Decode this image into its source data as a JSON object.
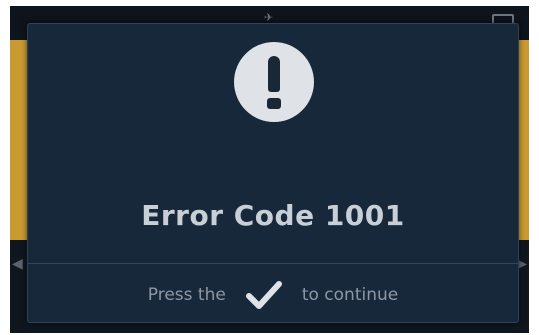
{
  "dialog": {
    "icon": "exclamation-circle-icon",
    "title": "Error Code 1001",
    "footer_prefix": "Press the",
    "footer_icon": "checkmark-icon",
    "footer_suffix": "to continue"
  },
  "colors": {
    "background_band": "#c99a32",
    "dialog_bg": "#16283a",
    "title_text": "#c9cfd6",
    "footer_text": "#8e97a2",
    "icon_circle": "#dfe3e8"
  }
}
